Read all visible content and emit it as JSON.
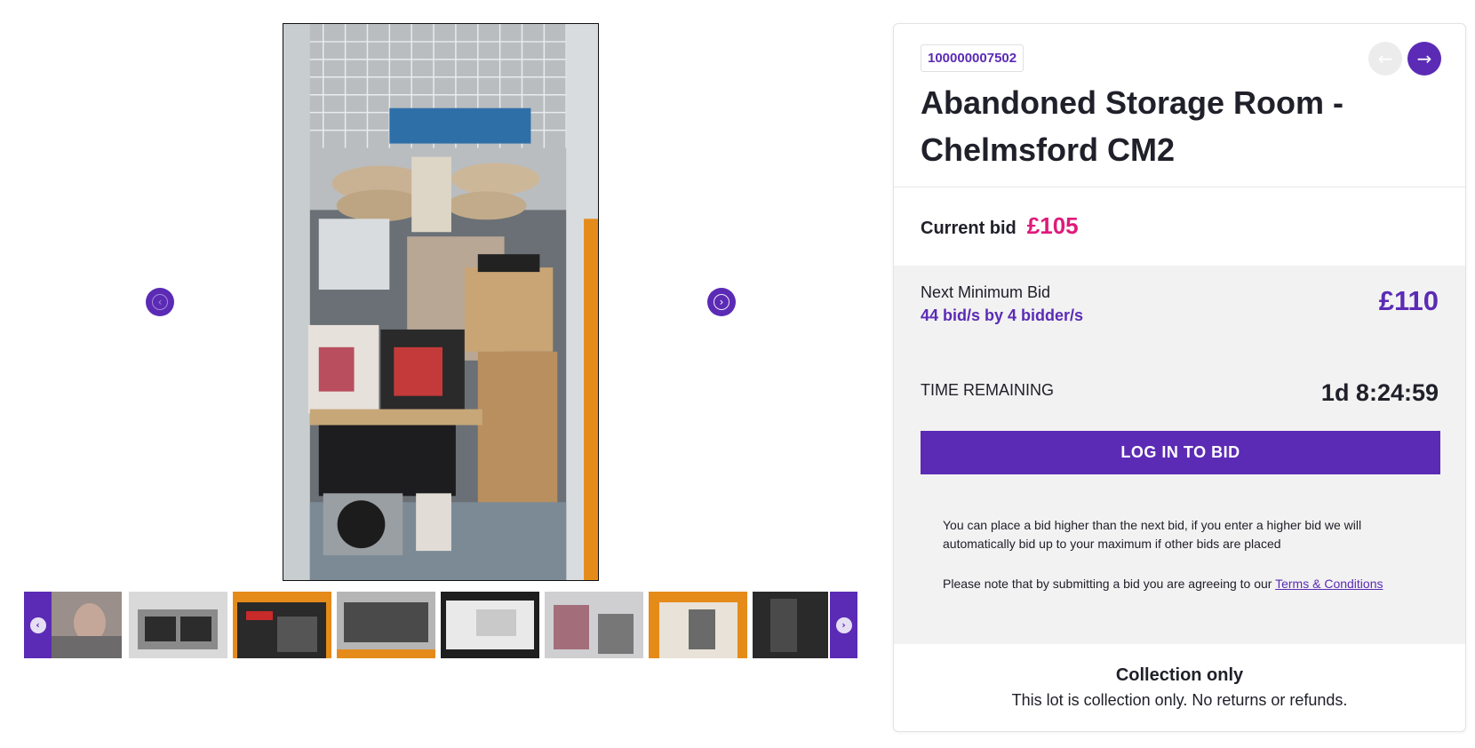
{
  "gallery": {
    "main_image_alt": "storage-unit-contents-photo",
    "prev_label": "‹",
    "next_label": "›",
    "thumbnails": [
      {
        "name": "thumb-1"
      },
      {
        "name": "thumb-2"
      },
      {
        "name": "thumb-3"
      },
      {
        "name": "thumb-4"
      },
      {
        "name": "thumb-5"
      },
      {
        "name": "thumb-6"
      },
      {
        "name": "thumb-7"
      },
      {
        "name": "thumb-8"
      }
    ],
    "strip_prev_icon": "chevron-left-icon",
    "strip_next_icon": "chevron-right-icon"
  },
  "lot": {
    "number": "100000007502",
    "title": "Abandoned Storage Room - Chelmsford CM2",
    "prev_icon": "arrow-left-icon",
    "next_icon": "arrow-right-icon"
  },
  "bidding": {
    "current_bid_label": "Current bid",
    "current_bid_value": "£105",
    "next_min_label": "Next Minimum Bid",
    "bid_count": "44 bid/s by 4 bidder/s",
    "next_min_value": "£110",
    "time_label": "TIME REMAINING",
    "time_value": "1d 8:24:59",
    "login_button": "LOG IN TO BID",
    "info_text": "You can place a bid higher than the next bid, if you enter a higher bid we will automatically bid up to your maximum if other bids are placed",
    "terms_prefix": "Please note that by submitting a bid you are agreeing to our ",
    "terms_link": "Terms & Conditions"
  },
  "collection": {
    "title": "Collection only",
    "text": "This lot is collection only. No returns or refunds."
  },
  "colors": {
    "accent": "#5b2bb5",
    "bid_highlight": "#e0197a",
    "panel_bg": "#f2f2f2"
  }
}
